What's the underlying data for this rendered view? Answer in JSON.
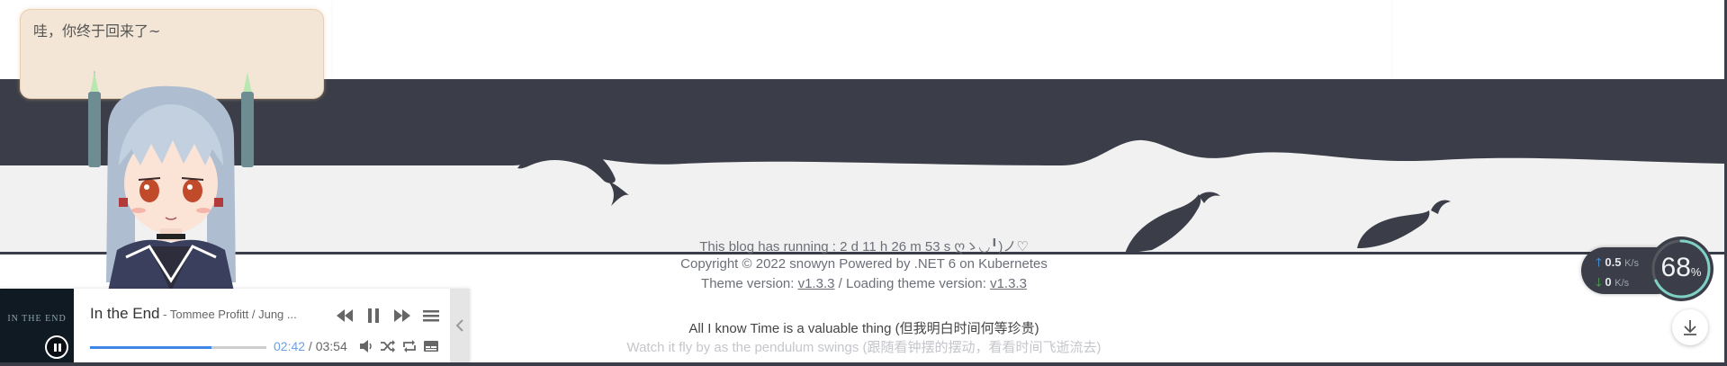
{
  "bubble": {
    "text": "哇，你终于回来了~"
  },
  "footer": {
    "running_text": "This blog has running : 2 d 11 h 26 m 53 s ღゝ◡╹)ノ♡",
    "copyright": "Copyright © 2022 snowyn Powered by .NET 6 on Kubernetes",
    "theme_prefix": "Theme version: ",
    "theme_version": "v1.3.3",
    "loading_prefix": " / Loading theme version: ",
    "loading_version": "v1.3.3",
    "quote_line1": "All I know Time is a valuable thing (但我明白时间何等珍贵)",
    "quote_line2": "Watch it fly by as the pendulum swings (跟随看钟摆的摆动，看看时间飞逝流去)"
  },
  "player": {
    "cover_text": "IN THE END",
    "song_title": "In the End",
    "song_artist": " - Tommee Profitt / Jung ...",
    "current_time": "02:42",
    "separator": " / ",
    "total_time": "03:54",
    "progress": 0.69
  },
  "network": {
    "upload_value": "0.5",
    "upload_unit": "K/s",
    "download_value": "0",
    "download_unit": "K/s"
  },
  "gauge": {
    "value": "68",
    "unit": "%"
  },
  "colors": {
    "dark_band": "#3b3e48",
    "light_band": "#f1f1f1",
    "accent_blue": "#3f86e8",
    "upload_arrow": "#4aa3f0",
    "download_arrow": "#4caf50"
  },
  "icons": {
    "prev": "skip-back-icon",
    "pause": "pause-icon",
    "next": "skip-forward-icon",
    "menu": "list-icon",
    "volume": "volume-icon",
    "shuffle": "shuffle-icon",
    "repeat": "repeat-icon",
    "lyrics": "lyrics-icon",
    "collapse": "chevron-left-icon",
    "download": "download-icon"
  }
}
